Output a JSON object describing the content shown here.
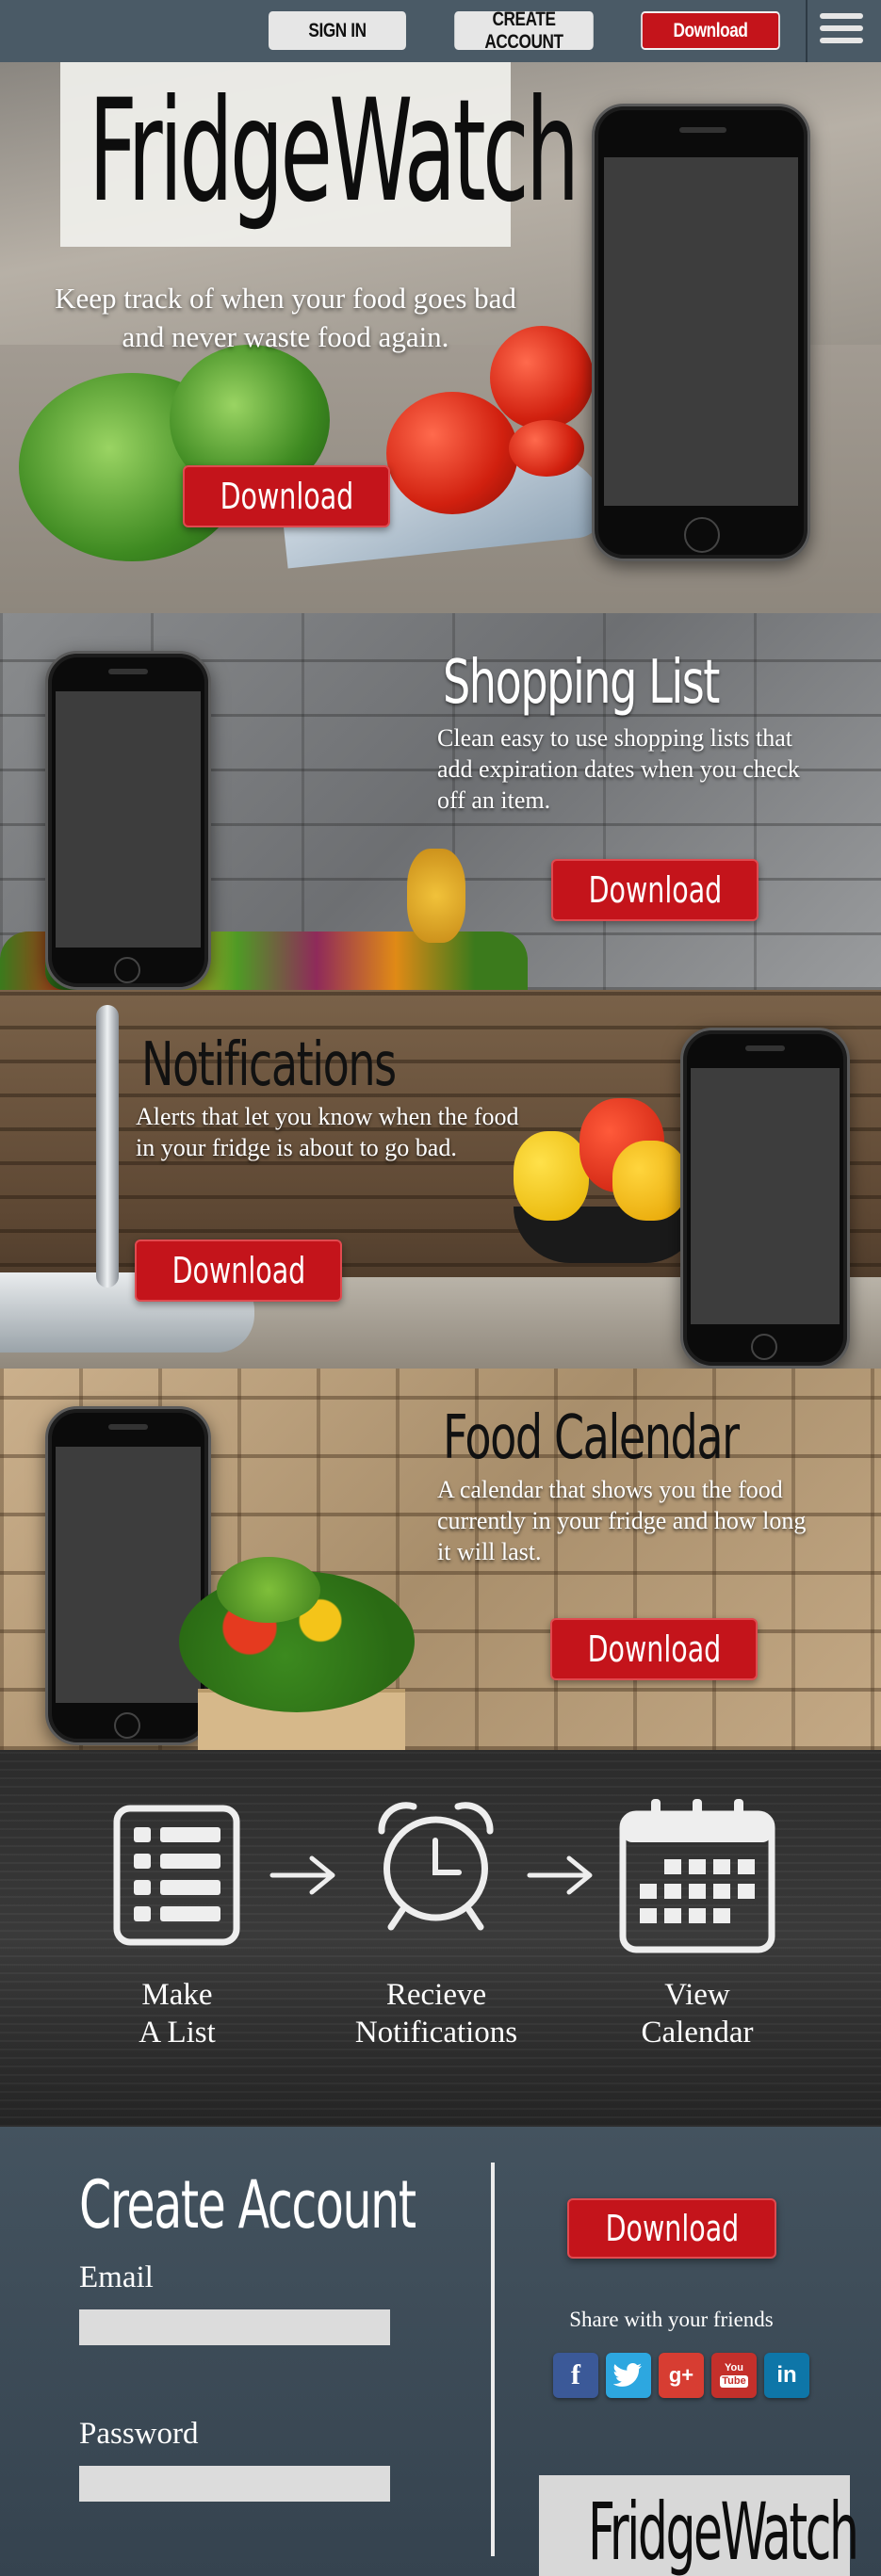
{
  "nav": {
    "sign_in": "SIGN IN",
    "create_account": "CREATE ACCOUNT",
    "download": "Download"
  },
  "hero": {
    "logo": "FridgeWatch",
    "tagline": "Keep track of when your food goes bad and never waste food again.",
    "download": "Download"
  },
  "features": {
    "shopping": {
      "title": "Shopping List",
      "description": "Clean easy to use shopping lists that add expiration dates when you check off an item.",
      "download": "Download"
    },
    "notifications": {
      "title": "Notifications",
      "description": "Alerts that let you know when the food in your fridge is about to go bad.",
      "download": "Download"
    },
    "calendar": {
      "title": "Food Calendar",
      "description": "A calendar that shows you the food currently in your fridge and how long it will last.",
      "download": "Download"
    }
  },
  "steps": [
    {
      "line1": "Make",
      "line2": "A List",
      "icon": "list-icon"
    },
    {
      "line1": "Recieve",
      "line2": "Notifications",
      "icon": "alarm-clock-icon"
    },
    {
      "line1": "View",
      "line2": "Calendar",
      "icon": "calendar-icon"
    }
  ],
  "footer": {
    "title": "Create Account",
    "email_label": "Email",
    "password_label": "Password",
    "download": "Download",
    "share_text": "Share with your friends",
    "social": [
      {
        "name": "facebook",
        "glyph": "f",
        "color": "#3b5998"
      },
      {
        "name": "twitter",
        "glyph": "t",
        "color": "#2da7e0"
      },
      {
        "name": "google-plus",
        "glyph": "g+",
        "color": "#d73d32"
      },
      {
        "name": "youtube",
        "glyph": "You Tube",
        "color": "#c4302b"
      },
      {
        "name": "linkedin",
        "glyph": "in",
        "color": "#0e76a8"
      }
    ],
    "logo": "FridgeWatch"
  },
  "colors": {
    "accent_red": "#c4141b",
    "nav_bg": "#4a5a66",
    "footer_bg": "#3c4b57"
  }
}
